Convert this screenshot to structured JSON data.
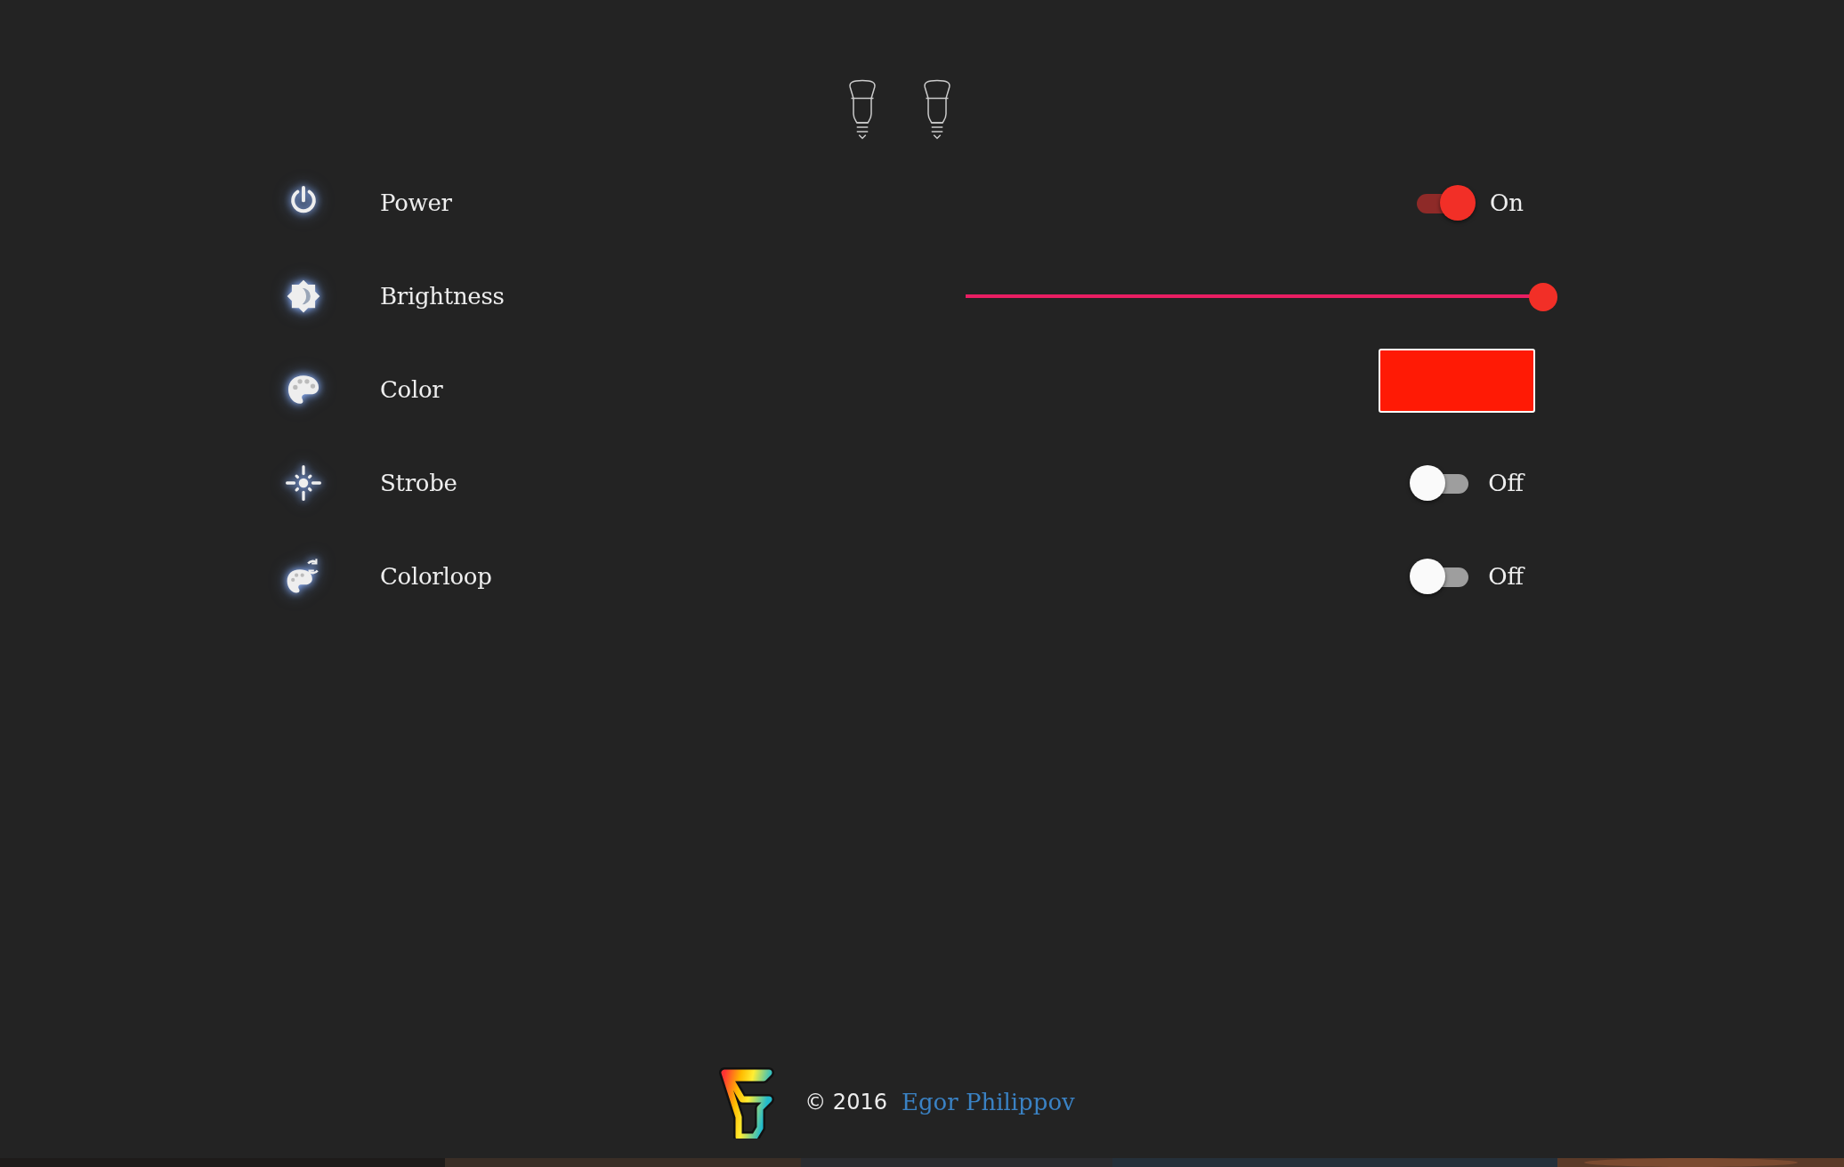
{
  "controls": [
    {
      "kind": "toggle",
      "label": "Power",
      "on": true,
      "state_text": "On"
    },
    {
      "kind": "slider",
      "label": "Brightness",
      "level": 0.98
    },
    {
      "kind": "color",
      "label": "Color",
      "color": "#ff1a05"
    },
    {
      "kind": "toggle",
      "label": "Strobe",
      "on": false,
      "state_text": "Off"
    },
    {
      "kind": "toggle",
      "label": "Colorloop",
      "on": false,
      "state_text": "Off"
    }
  ],
  "footer": {
    "copyright": "© 2016",
    "author": "Egor Philippov"
  }
}
